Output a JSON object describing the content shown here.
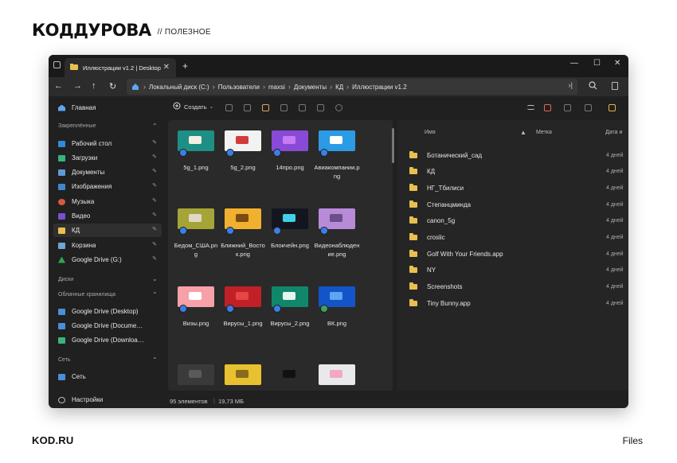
{
  "brand": {
    "logo": "КОДДУРОВА",
    "tag": "// ПОЛЕЗНОЕ",
    "site": "KOD.RU",
    "category": "Files"
  },
  "window": {
    "tab_title": "Иллюстрации v1.2 | Desktop",
    "breadcrumb": [
      "Локальный диск (C:)",
      "Пользователи",
      "maxsi",
      "Документы",
      "КД",
      "Иллюстрации v1.2"
    ],
    "status_count": "95 элементов",
    "status_size": "19,73 МБ",
    "create_label": "Создать"
  },
  "sidebar": {
    "home": "Главная",
    "pinned_header": "Закреплённые",
    "pinned": [
      {
        "label": "Рабочий стол",
        "color": "#2f8ad8"
      },
      {
        "label": "Загрузки",
        "color": "#37b37e"
      },
      {
        "label": "Документы",
        "color": "#5e9ad8"
      },
      {
        "label": "Изображения",
        "color": "#3f86d0"
      },
      {
        "label": "Музыка",
        "color": "#d8573f"
      },
      {
        "label": "Видео",
        "color": "#7a4fd0"
      },
      {
        "label": "КД",
        "color": "#e8c04f"
      },
      {
        "label": "Корзина",
        "color": "#6aa7d8"
      },
      {
        "label": "Google Drive (G:)",
        "color": "#2fa84f"
      }
    ],
    "drives_header": "Диски",
    "cloud_header": "Облачные хранилища",
    "cloud": [
      {
        "label": "Google Drive (Desktop)",
        "color": "#4a90d8"
      },
      {
        "label": "Google Drive (Docume…",
        "color": "#4a90d8"
      },
      {
        "label": "Google Drive (Downloa…",
        "color": "#37b37e"
      }
    ],
    "network_header": "Сеть",
    "network_item": "Сеть",
    "settings": "Настройки"
  },
  "grid": [
    {
      "label": "5g_1.png",
      "bg": "#1d8f85",
      "fg": "#f3efe2"
    },
    {
      "label": "5g_2.png",
      "bg": "#f2f2f2",
      "fg": "#d23b3b"
    },
    {
      "label": "14про.png",
      "bg": "#8a4ad8",
      "fg": "#c77af2"
    },
    {
      "label": "Авиакомпании.png",
      "bg": "#2c9be6",
      "fg": "#ffffff"
    },
    {
      "label": "Бедом_США.png",
      "bg": "#a6a437",
      "fg": "#e0d8c8"
    },
    {
      "label": "Ближний_Восток.png",
      "bg": "#f1b12e",
      "fg": "#7a4b12"
    },
    {
      "label": "Блокчейн.png",
      "bg": "#131520",
      "fg": "#3fd0e8"
    },
    {
      "label": "Видеонаблюдение.png",
      "bg": "#b78bd8",
      "fg": "#6a4f8a"
    },
    {
      "label": "Визы.png",
      "bg": "#f6a0a8",
      "fg": "#ffffff"
    },
    {
      "label": "Вирусы_1.png",
      "bg": "#c02026",
      "fg": "#e84646"
    },
    {
      "label": "Вирусы_2.png",
      "bg": "#10876b",
      "fg": "#e6f3ee"
    },
    {
      "label": "ВК.png",
      "bg": "#1554c8",
      "fg": "#5ea6f0"
    },
    {
      "label": "",
      "bg": "#3a3a3a",
      "fg": "#5a5a5a"
    },
    {
      "label": "",
      "bg": "#e8c22e",
      "fg": "#8a6a20"
    },
    {
      "label": "",
      "bg": "#2a2a2a",
      "fg": "#111111"
    },
    {
      "label": "",
      "bg": "#e9e9ec",
      "fg": "#f2a8c4"
    }
  ],
  "list": {
    "headers": {
      "name": "Имя",
      "tag": "Метка",
      "date": "Дата и"
    },
    "rows": [
      {
        "name": "Ботанический_сад",
        "date": "4 дней"
      },
      {
        "name": "КД",
        "date": "4 дней"
      },
      {
        "name": "НГ_Тбилиси",
        "date": "4 дней"
      },
      {
        "name": "Степанцминда",
        "date": "4 дней"
      },
      {
        "name": "canon_5g",
        "date": "4 дней"
      },
      {
        "name": "croslic",
        "date": "4 дней"
      },
      {
        "name": "Golf With Your Friends.app",
        "date": "4 дней"
      },
      {
        "name": "NY",
        "date": "4 дней"
      },
      {
        "name": "Screenshots",
        "date": "4 дней"
      },
      {
        "name": "Tiny Bunny.app",
        "date": "4 дней"
      }
    ]
  }
}
